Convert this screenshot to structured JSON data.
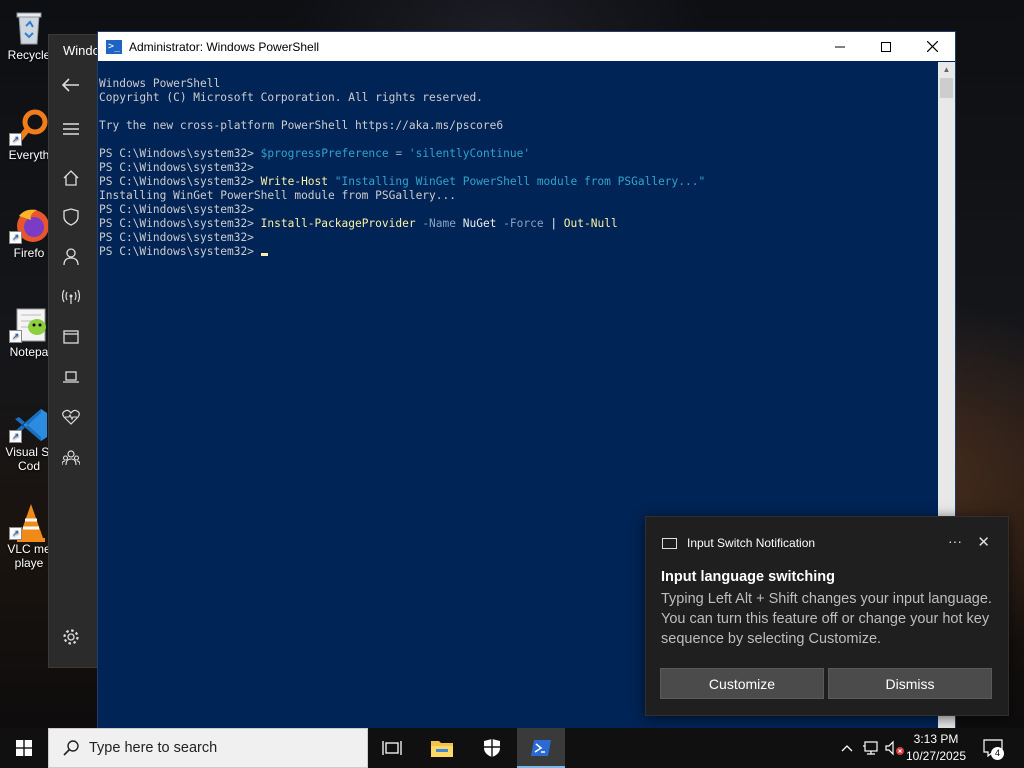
{
  "desktop": {
    "icons": [
      {
        "label": "Recycle",
        "icon": "recycle-bin-icon"
      },
      {
        "label": "Everyth",
        "icon": "everything-search-icon"
      },
      {
        "label": "Firefo",
        "icon": "firefox-icon"
      },
      {
        "label": "Notepa",
        "icon": "notepad-plus-plus-icon"
      },
      {
        "label_line1": "Visual St",
        "label_line2": "Cod",
        "icon": "vscode-icon"
      },
      {
        "label_line1": "VLC me",
        "label_line2": "playe",
        "icon": "vlc-icon"
      }
    ]
  },
  "settings_window": {
    "title": "Windo",
    "nav_icons": [
      "back-arrow-icon",
      "hamburger-menu-icon",
      "home-icon",
      "shield-icon",
      "person-icon",
      "wireless-icon",
      "window-icon",
      "laptop-icon",
      "heart-pulse-icon",
      "family-icon",
      "gear-icon"
    ]
  },
  "powershell": {
    "title": "Administrator: Windows PowerShell",
    "lines": {
      "l1": "Windows PowerShell",
      "l2": "Copyright (C) Microsoft Corporation. All rights reserved.",
      "l4": "Try the new cross-platform PowerShell https://aka.ms/pscore6",
      "prompt": "PS C:\\Windows\\system32> ",
      "l6_var": "$progressPreference",
      "l6_op": " = ",
      "l6_str": "'silentlyContinue'",
      "l8_cmd": "Write-Host",
      "l8_str": " \"Installing WinGet PowerShell module from PSGallery...\"",
      "l9": "Installing WinGet PowerShell module from PSGallery...",
      "l11_cmd": "Install-PackageProvider",
      "l11_p1": " -Name",
      "l11_v1": " NuGet",
      "l11_p2": " -Force",
      "l11_pipe": " | ",
      "l11_cmd2": "Out-Null"
    }
  },
  "toast": {
    "app_name": "Input Switch Notification",
    "more_glyph": "···",
    "close_glyph": "✕",
    "heading": "Input language switching",
    "body": "Typing Left Alt + Shift changes your input language. You can turn this feature off or change your hot key sequence by selecting Customize.",
    "customize_label": "Customize",
    "dismiss_label": "Dismiss"
  },
  "taskbar": {
    "search_placeholder": "Type here to search",
    "apps": [
      "task-view-icon",
      "file-explorer-icon",
      "windows-security-icon",
      "powershell-icon"
    ],
    "clock_time": "3:13 PM",
    "clock_date": "10/27/2025",
    "notification_count": "4",
    "accent": "#76b9ed"
  }
}
